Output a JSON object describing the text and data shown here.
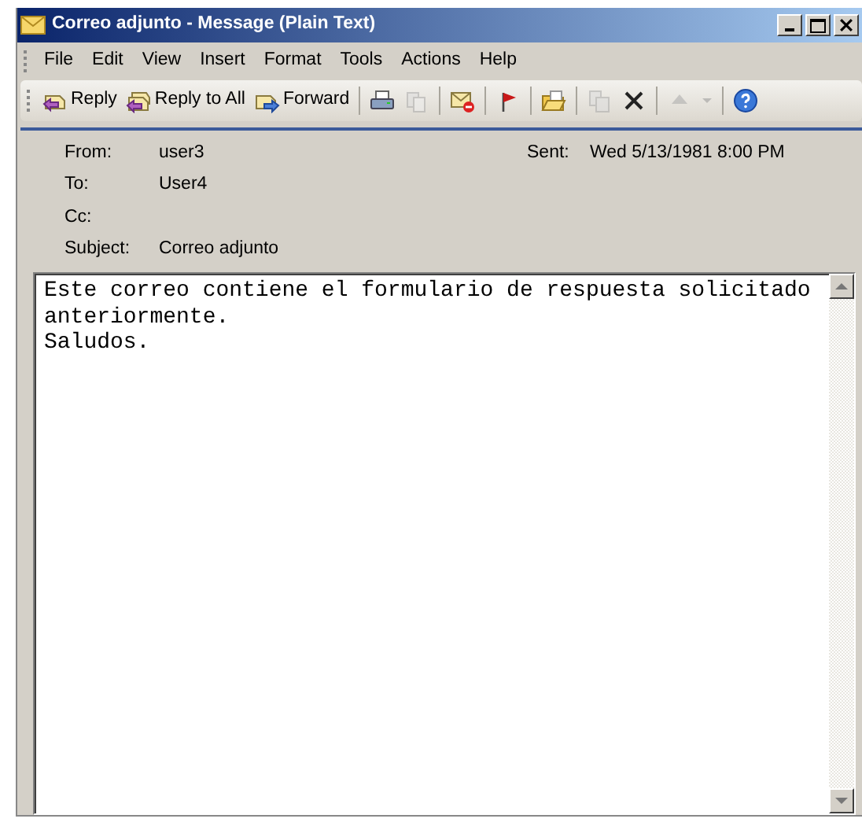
{
  "window": {
    "title": "Correo adjunto - Message (Plain Text)"
  },
  "menu": [
    "File",
    "Edit",
    "View",
    "Insert",
    "Format",
    "Tools",
    "Actions",
    "Help"
  ],
  "toolbar": [
    {
      "kind": "labeled",
      "label": "Reply"
    },
    {
      "kind": "labeled",
      "label": "Reply to All"
    },
    {
      "kind": "labeled",
      "label": "Forward"
    },
    {
      "kind": "sep"
    },
    {
      "kind": "icon",
      "disabled": false
    },
    {
      "kind": "icon",
      "disabled": true
    },
    {
      "kind": "sep"
    },
    {
      "kind": "icon",
      "disabled": false
    },
    {
      "kind": "sep"
    },
    {
      "kind": "icon",
      "disabled": false
    },
    {
      "kind": "sep"
    },
    {
      "kind": "icon",
      "disabled": false
    },
    {
      "kind": "sep"
    },
    {
      "kind": "icon",
      "disabled": true
    },
    {
      "kind": "icon",
      "disabled": false
    },
    {
      "kind": "sep"
    },
    {
      "kind": "icon",
      "disabled": true
    },
    {
      "kind": "icon",
      "disabled": true
    },
    {
      "kind": "sep"
    },
    {
      "kind": "icon",
      "disabled": false
    }
  ],
  "header": {
    "from_label": "From:",
    "from": "user3",
    "sent_label": "Sent:",
    "sent": "Wed 5/13/1981 8:00 PM",
    "to_label": "To:",
    "to": "User4",
    "cc_label": "Cc:",
    "subject_label": "Subject:",
    "subject": "Correo adjunto"
  },
  "body": [
    "Este correo contiene el formulario de respuesta solicitado",
    "anteriormente.",
    "Saludos."
  ]
}
